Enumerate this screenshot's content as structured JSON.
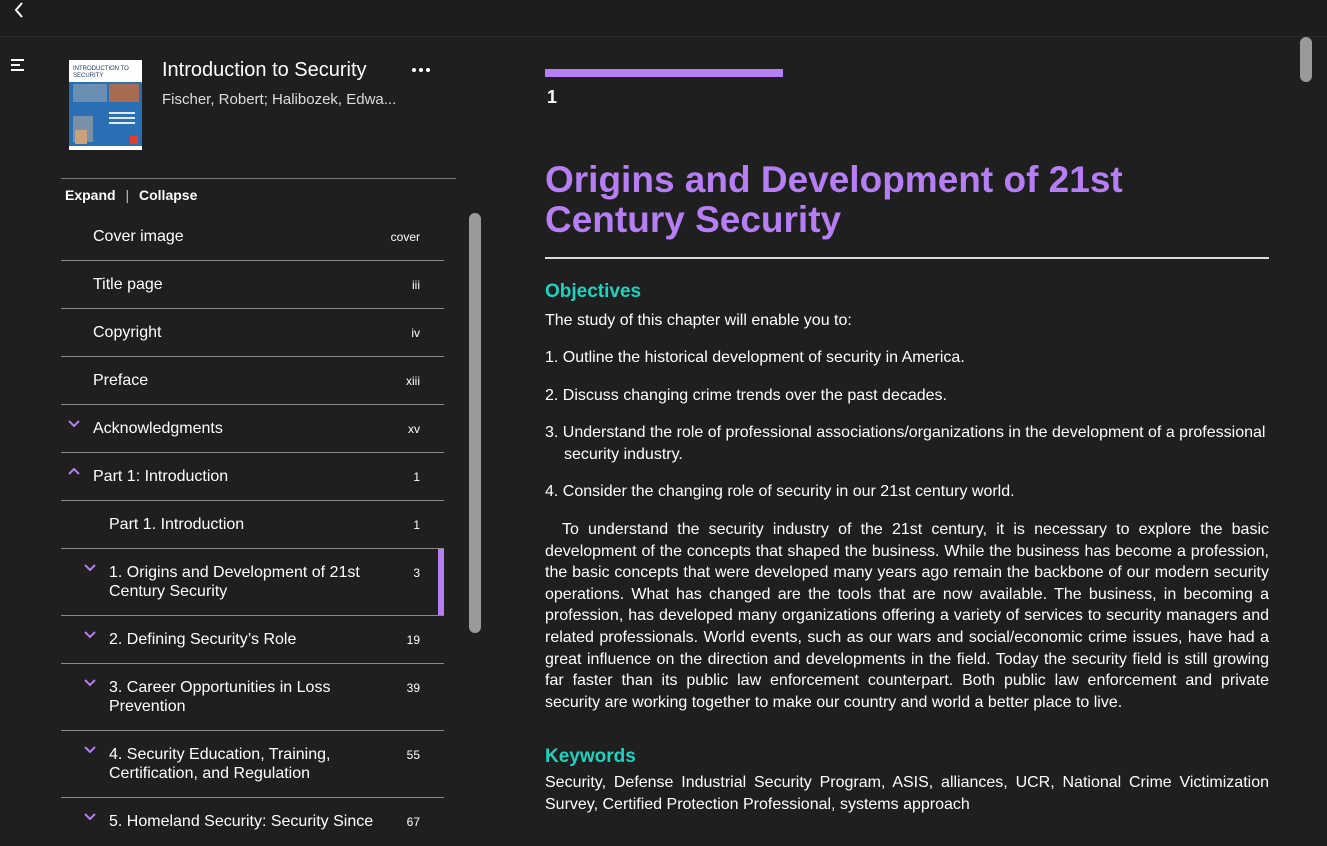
{
  "topbar": {
    "back_icon": "chevron-left-icon"
  },
  "book": {
    "title": "Introduction to Security",
    "author": "Fischer, Robert; Halibozek, Edwa...",
    "cover_title": "INTRODUCTION TO SECURITY"
  },
  "sidebar": {
    "expand_label": "Expand",
    "separator": "|",
    "collapse_label": "Collapse",
    "toc": [
      {
        "label": "Cover image",
        "page": "cover",
        "chevron": "none",
        "level": 1
      },
      {
        "label": "Title page",
        "page": "iii",
        "chevron": "none",
        "level": 1
      },
      {
        "label": "Copyright",
        "page": "iv",
        "chevron": "none",
        "level": 1
      },
      {
        "label": "Preface",
        "page": "xiii",
        "chevron": "none",
        "level": 1
      },
      {
        "label": "Acknowledgments",
        "page": "xv",
        "chevron": "down",
        "level": 1
      },
      {
        "label": "Part 1: Introduction",
        "page": "1",
        "chevron": "up",
        "level": 1
      },
      {
        "label": "Part 1. Introduction",
        "page": "1",
        "chevron": "none",
        "level": 2
      },
      {
        "label": "1. Origins and Development of 21st Century Security",
        "page": "3",
        "chevron": "down",
        "level": 2,
        "active": true
      },
      {
        "label": "2. Defining Security’s Role",
        "page": "19",
        "chevron": "down",
        "level": 2
      },
      {
        "label": "3. Career Opportunities in Loss Prevention",
        "page": "39",
        "chevron": "down",
        "level": 2
      },
      {
        "label": "4. Security Education, Training, Certification, and Regulation",
        "page": "55",
        "chevron": "down",
        "level": 2
      },
      {
        "label": "5. Homeland Security: Security Since",
        "page": "67",
        "chevron": "down",
        "level": 2
      }
    ]
  },
  "content": {
    "chapter_number": "1",
    "chapter_title": "Origins and Development of 21st Century Security",
    "objectives_heading": "Objectives",
    "objectives_intro": "The study of this chapter will enable you to:",
    "objectives": [
      "1. Outline the historical development of security in America.",
      "2. Discuss changing crime trends over the past decades.",
      "3. Understand the role of professional associations/organizations in the development of a professional security industry.",
      "4. Consider the changing role of security in our 21st century world."
    ],
    "paragraph": "To understand the security industry of the 21st century, it is necessary to explore the basic development of the concepts that shaped the business. While the business has become a profession, the basic concepts that were developed many years ago remain the backbone of our modern security operations. What has changed are the tools that are now available. The business, in becoming a profession, has developed many organizations offering a variety of services to security managers and related professionals. World events, such as our wars and social/economic crime issues, have had a great influence on the direction and developments in the field. Today the security field is still growing far faster than its public law enforcement counterpart. Both public law enforcement and private security are working together to make our country and world a better place to live.",
    "keywords_heading": "Keywords",
    "keywords": "Security, Defense Industrial Security Program, ASIS, alliances, UCR, National Crime Victimization Survey, Certified Protection Professional, systems approach"
  },
  "colors": {
    "accent": "#b57ff3",
    "heading_teal": "#1cd3c0",
    "background": "#1f1f1f"
  }
}
